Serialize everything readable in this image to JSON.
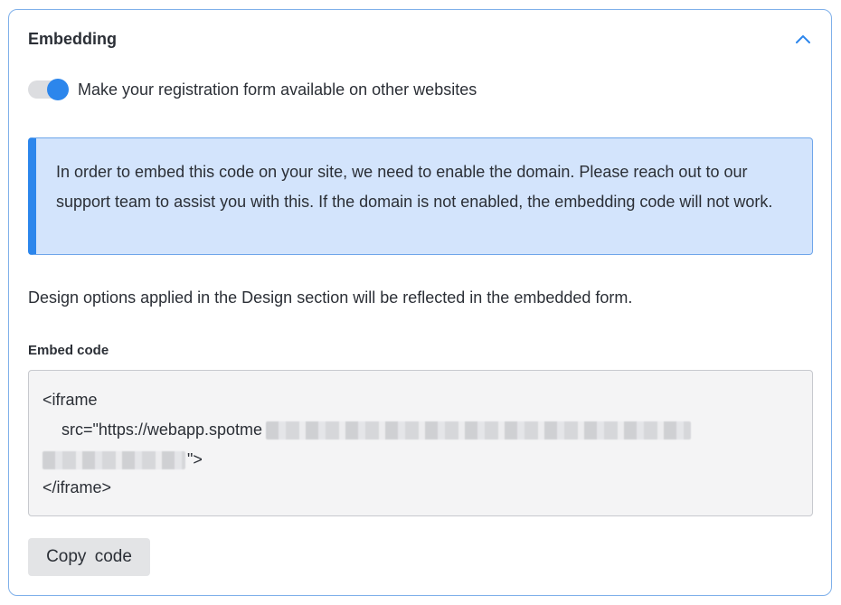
{
  "section": {
    "title": "Embedding",
    "collapse_icon": "chevron-up-icon",
    "accent_color": "#2c86ec"
  },
  "toggle": {
    "label": "Make your registration form available on other websites",
    "state": "on"
  },
  "info_box": {
    "text": "In order to embed this code on your site, we need to enable the domain. Please reach out to our support team to assist you with this. If the domain is not enabled, the embedding code will not work.",
    "background": "#d3e4fc"
  },
  "design_note": "Design options applied in the Design section will be reflected in the embedded form.",
  "embed": {
    "label": "Embed code",
    "line1": "<iframe",
    "line2_prefix": "src=\"https://webapp.spotme",
    "line3_suffix": "\">",
    "line4": "</iframe>"
  },
  "copy_button": {
    "label": "Copy  code"
  }
}
